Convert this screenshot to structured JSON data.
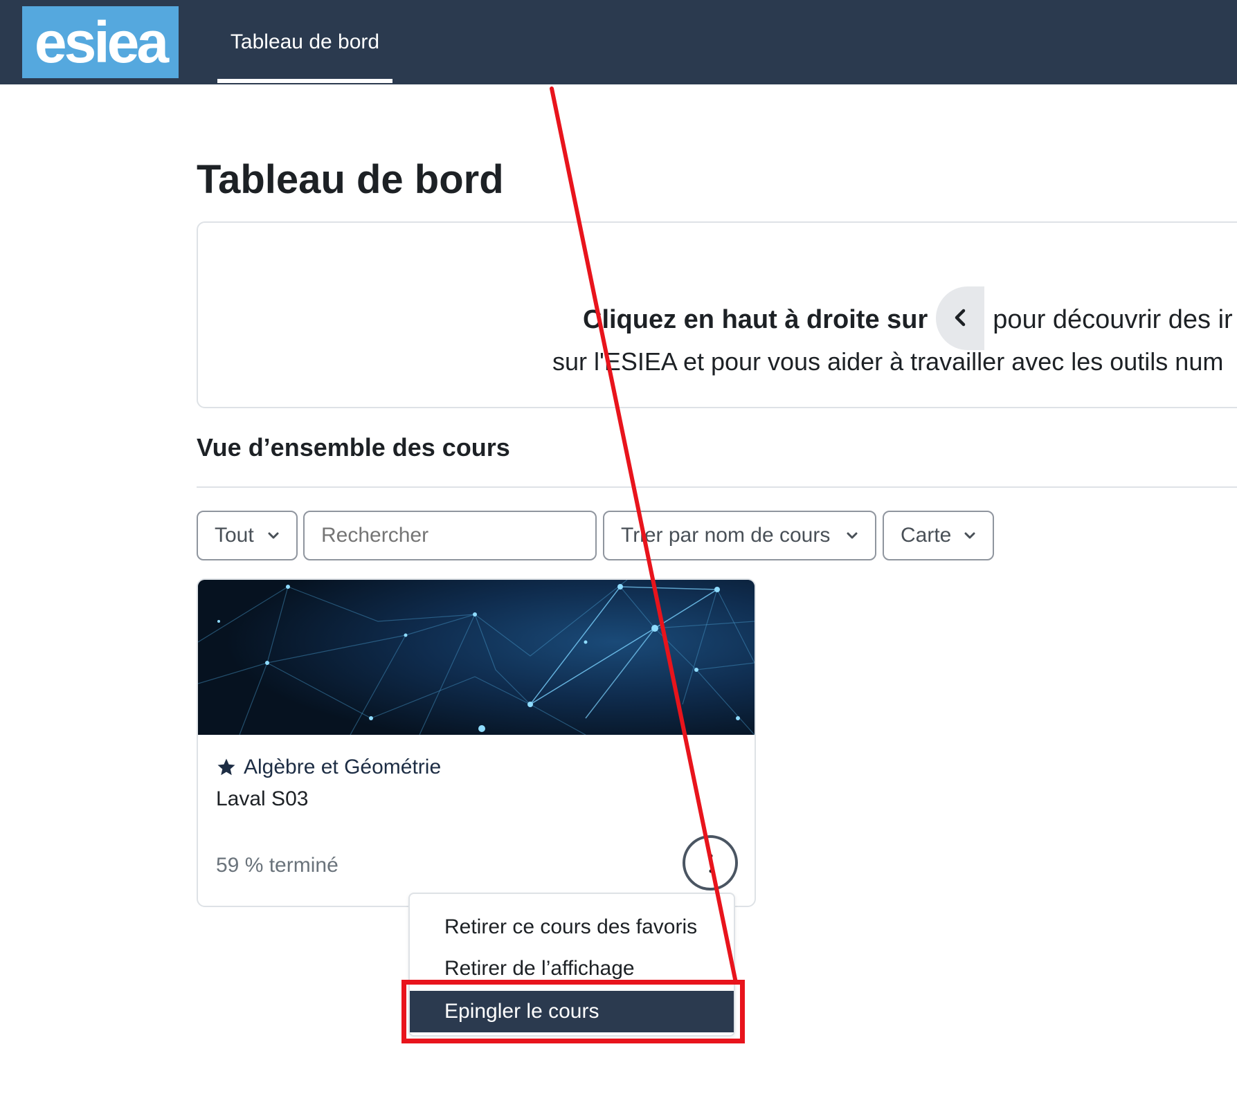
{
  "navbar": {
    "logo_text": "esiea",
    "tab_label": "Tableau de bord"
  },
  "page_title": "Tableau de bord",
  "info": {
    "line1_bold": "Cliquez en haut à droite sur",
    "line1_rest": "pour découvrir des ir",
    "line2": "sur l'ESIEA et pour vous aider à travailler avec les outils num"
  },
  "section_title": "Vue d’ensemble des cours",
  "filters": {
    "all_label": "Tout",
    "search_placeholder": "Rechercher",
    "sort_label": "Trier par nom de cours",
    "view_label": "Carte"
  },
  "course": {
    "name": "Algèbre et Géométrie",
    "category": "Laval S03",
    "progress_percent": 59,
    "progress_text": "59 % terminé"
  },
  "menu": {
    "items": [
      "Retirer ce cours des favoris",
      "Retirer de l’affichage",
      "Epingler le cours"
    ],
    "highlighted_index": 2
  },
  "colors": {
    "navbar": "#2b3a4f",
    "logo_bg": "#55a8de",
    "annotation": "#e8141c"
  }
}
